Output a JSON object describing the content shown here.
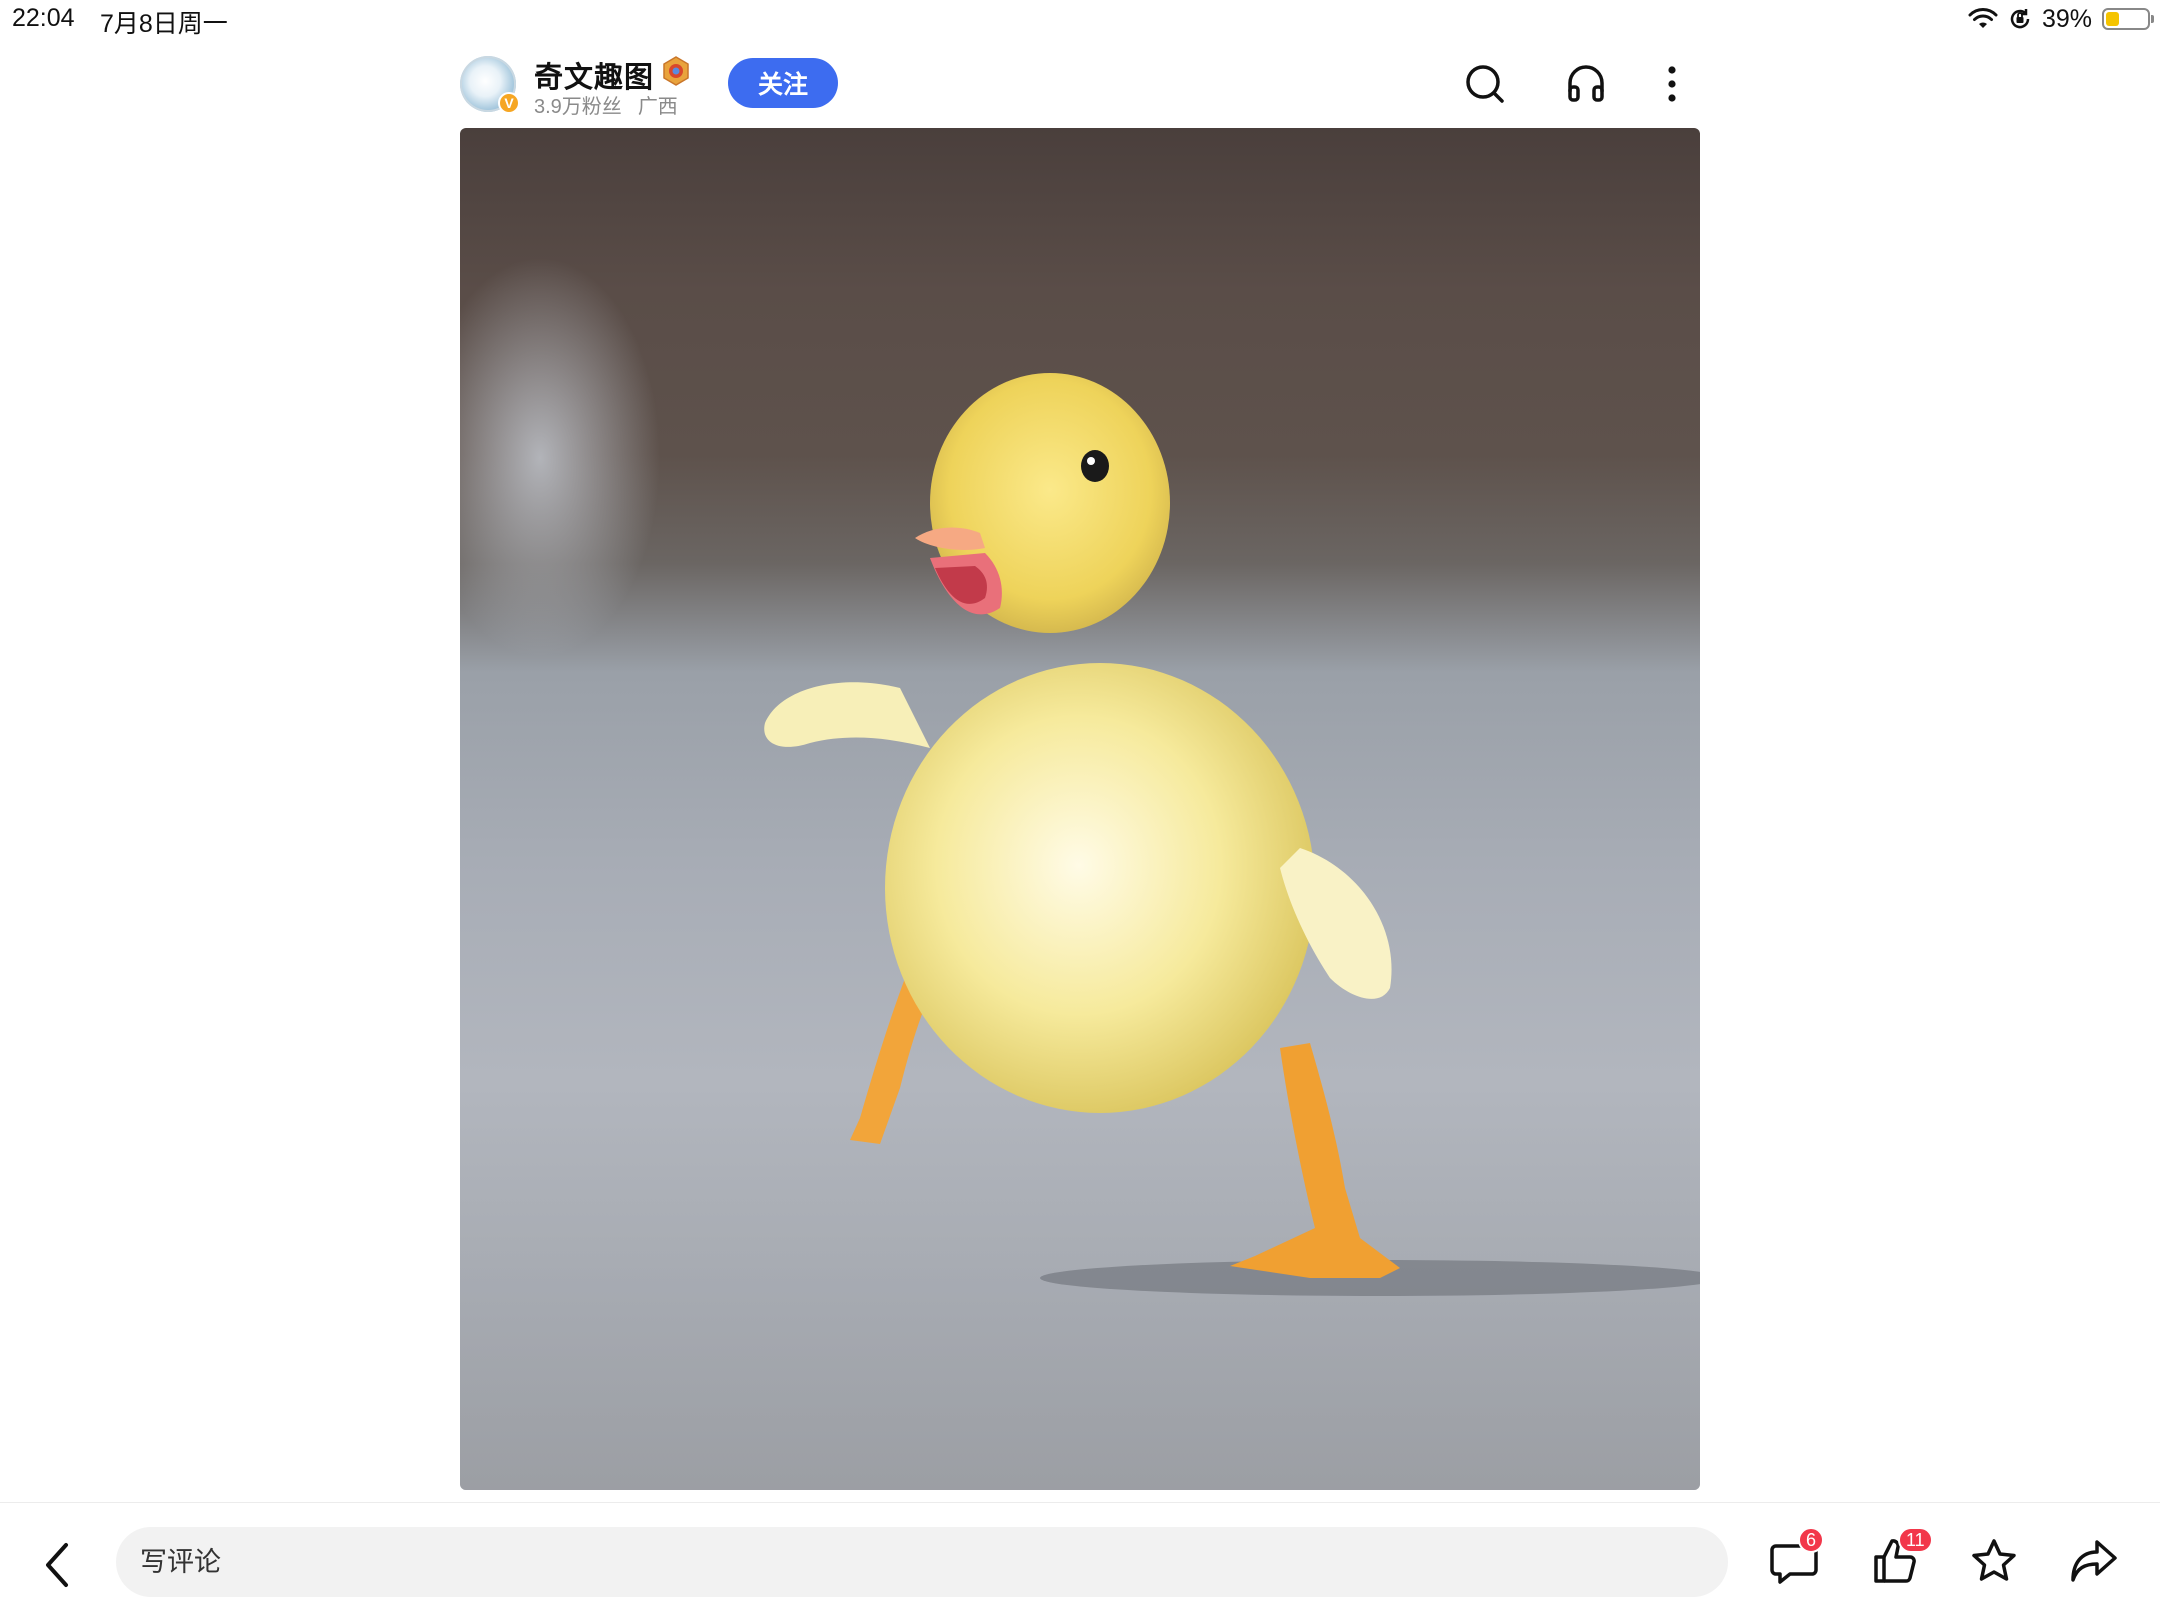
{
  "status_bar": {
    "time": "22:04",
    "date": "7月8日周一",
    "battery_percent": "39%",
    "battery_level": 0.39,
    "icons": [
      "wifi-icon",
      "orientation-lock-icon",
      "battery-icon"
    ]
  },
  "header": {
    "author_name": "奇文趣图",
    "followers": "3.9万粉丝",
    "location": "广西",
    "follow_label": "关注",
    "verified_mark": "V",
    "accent_color": "#3d6cf0",
    "icons": [
      "search-icon",
      "headphones-icon",
      "more-icon"
    ]
  },
  "content": {
    "image_subject": "duckling"
  },
  "bottom_bar": {
    "comment_placeholder": "写评论",
    "comment_count": "6",
    "like_count": "11",
    "badge_color": "#f2374a",
    "icons": [
      "back-icon",
      "comment-icon",
      "thumbs-up-icon",
      "star-icon",
      "share-icon"
    ]
  }
}
